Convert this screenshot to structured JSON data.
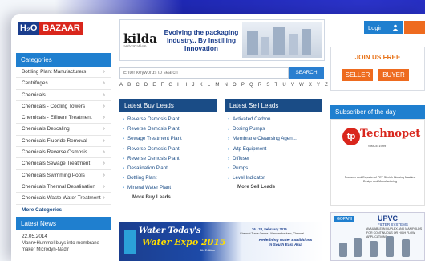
{
  "logo": {
    "part1": "H₂O",
    "part2": "BAZAAR"
  },
  "banner": {
    "brand": "kilda",
    "brand_sub": "automation",
    "tagline": "Evolving the packaging industry.. By Instilling Innovation"
  },
  "search": {
    "placeholder": "Enter keywords to search",
    "button": "SEARCH"
  },
  "alphabet": [
    "A",
    "B",
    "C",
    "D",
    "E",
    "F",
    "G",
    "H",
    "I",
    "J",
    "K",
    "L",
    "M",
    "N",
    "O",
    "P",
    "Q",
    "R",
    "S",
    "T",
    "U",
    "V",
    "W",
    "X",
    "Y",
    "Z"
  ],
  "categories": {
    "title": "Categories",
    "items": [
      "Bottling Plant Manufacturers",
      "Centrifuges",
      "Chemicals",
      "Chemicals - Cooling Towers",
      "Chemicals - Effluent Treatment",
      "Chemicals Descaling",
      "Chemicals Fluoride Removal",
      "Chemicals Reverse Osmosis",
      "Chemicals Sewage Treatment",
      "Chemicals Swimming Pools",
      "Chemicals Thermal Desalination",
      "Chemicals Waste Water Treatment"
    ],
    "more": "More Categories",
    "chevron": "›"
  },
  "news": {
    "title": "Latest News",
    "date": "22.05.2014",
    "text": "Mann+Hummel buys into membrane-maker Microdyn-Nadir"
  },
  "buy_leads": {
    "title": "Latest Buy Leads",
    "items": [
      "Reverse Osmosis Plant",
      "Reverse Osmosis Plant",
      "Sewage Treatment Plant",
      "Reverse Osmosis Plant",
      "Reverse Osmosis Plant",
      "Desalination Plant",
      "Bottling Plant",
      "Mineral Water Plant"
    ],
    "more": "More Buy Leads"
  },
  "sell_leads": {
    "title": "Latest Sell Leads",
    "items": [
      "Activated Carbon",
      "Dosing Pumps",
      "Membrane Cleansing Agent...",
      "Wtp Equipment",
      "Diffuser",
      "Pumps",
      "Level Indicator"
    ],
    "more": "More Sell Leads"
  },
  "login": {
    "label": "Login",
    "icon": "user-icon"
  },
  "join": {
    "title": "JOIN US FREE",
    "seller": "SELLER",
    "buyer": "BUYER"
  },
  "subscriber": {
    "title": "Subscriber of the day",
    "logo_letter": "tp",
    "name": "Technopet",
    "since": "SINCE 1999",
    "desc": "Producer and Exporter of PET Stretch Blowing Machine Design and Manufacturing"
  },
  "water_expo": {
    "line1": "Water Today's",
    "line2": "Water Expo 2015",
    "edition": "9th Edition",
    "dates": "26 - 28, February 2015",
    "venue": "Chennai Trade Centre , Nandambakkam, Chennai",
    "slogan": "Redefining Water Exhibitions In South East Asia"
  },
  "gopani": {
    "brand": "GOPANI",
    "product": "UPVC",
    "product_sub": "FILTER SYSTEMS",
    "desc": "AVAILABLE IN DUPLEX AND MANIFOLDS FOR CONTINUOUS OR HIGH FLOW APPLICATIONS"
  },
  "colors": {
    "primary": "#1f7fcf",
    "dark": "#1a4c86",
    "orange": "#ee6b1f",
    "background": "#1f28b4"
  }
}
